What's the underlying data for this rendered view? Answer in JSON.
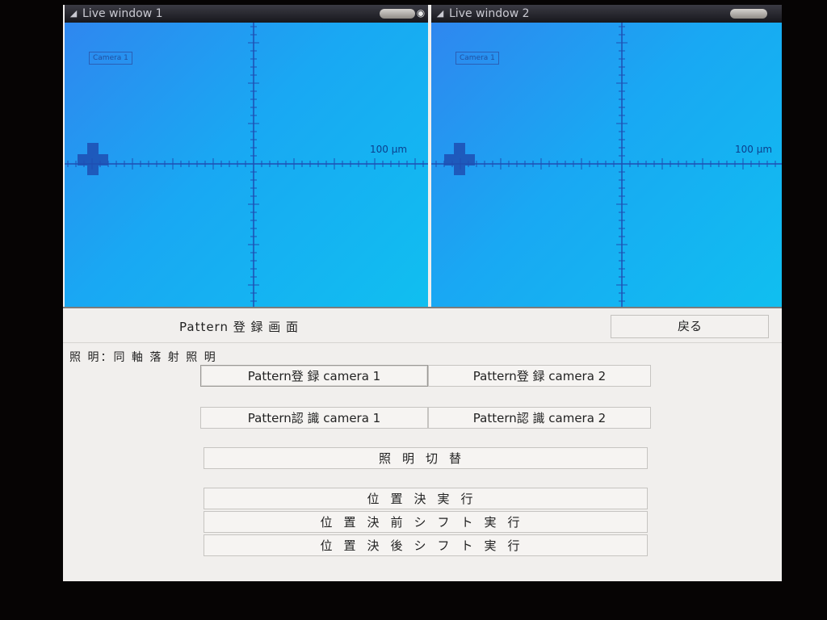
{
  "live_windows": [
    {
      "title": "Live window  1",
      "camera_tag": "Camera 1",
      "scale_label": "100 μm"
    },
    {
      "title": "Live window  2",
      "camera_tag": "Camera 1",
      "scale_label": "100 μm"
    }
  ],
  "icons": {
    "window_menu": "window-menu-icon",
    "close": "close-icon",
    "scroll_thumb": "scroll-thumb"
  },
  "colors": {
    "view_blue": "#19a8f3",
    "crosshair": "#1e4fb3",
    "panel_bg": "#f1efed"
  },
  "panel": {
    "heading": "Pattern 登 録 画 面",
    "back_label": "戻る",
    "lighting_status": "照 明：同 軸 落 射 照 明",
    "buttons": {
      "register_cam1": "Pattern登 録  camera 1",
      "register_cam2": "Pattern登 録  camera 2",
      "recognize_cam1": "Pattern認 識  camera 1",
      "recognize_cam2": "Pattern認 識  camera 2",
      "lighting_switch": "照明切替",
      "position_run": "位置決実行",
      "position_pre_shift": "位置決前シフト実行",
      "position_post_shift": "位置決後シフト実行"
    }
  }
}
